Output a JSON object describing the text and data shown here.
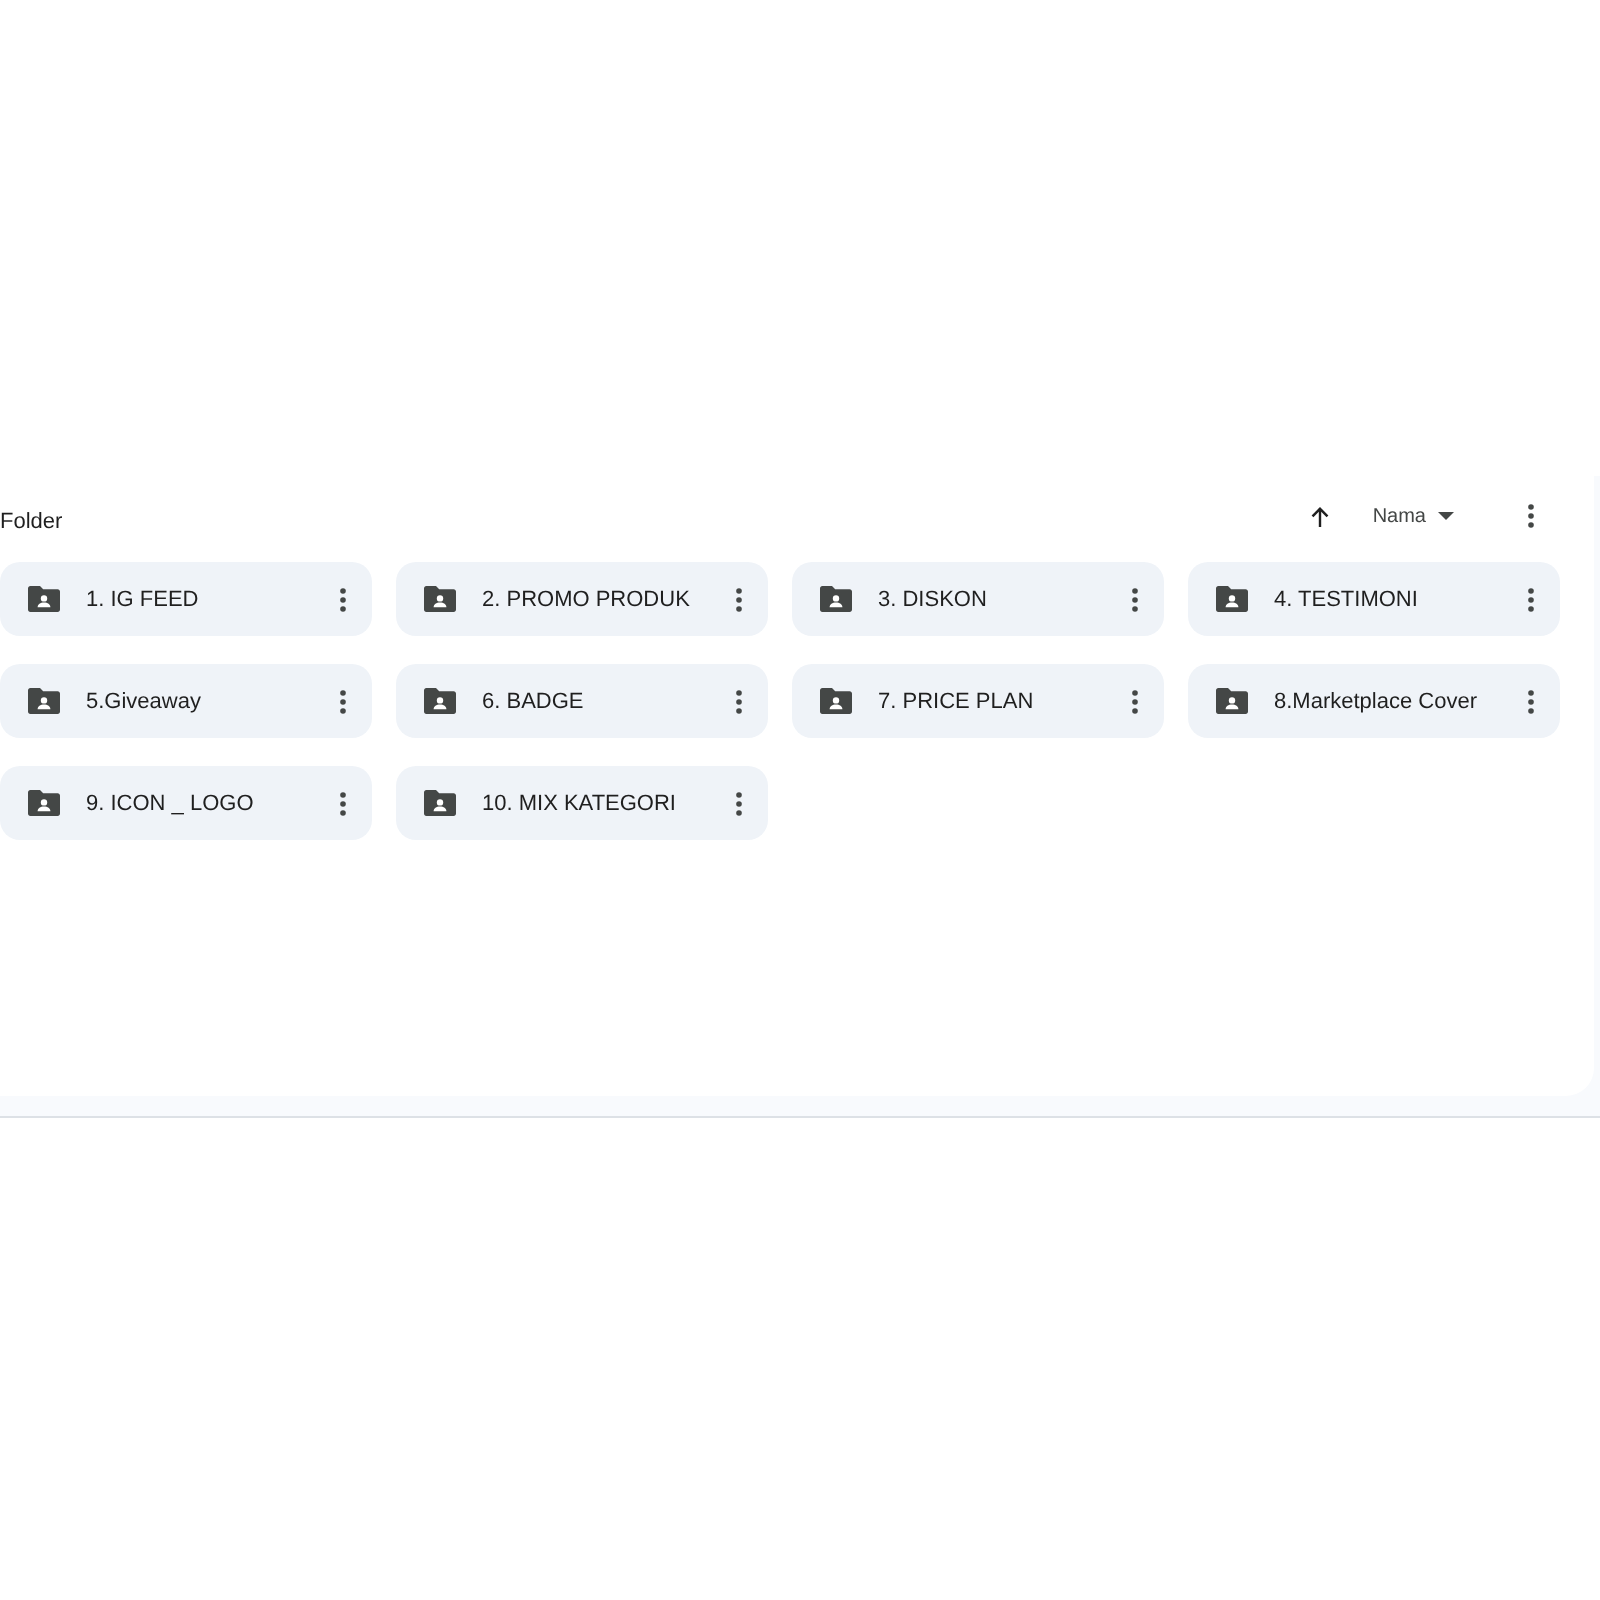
{
  "header": {
    "title": "Folder",
    "sort": {
      "ascending": true,
      "label": "Nama"
    }
  },
  "folders": [
    {
      "name": "1. IG FEED"
    },
    {
      "name": "2. PROMO PRODUK"
    },
    {
      "name": "3. DISKON"
    },
    {
      "name": "4. TESTIMONI"
    },
    {
      "name": "5.Giveaway"
    },
    {
      "name": "6. BADGE"
    },
    {
      "name": "7. PRICE PLAN"
    },
    {
      "name": "8.Marketplace Cover"
    },
    {
      "name": "9. ICON _ LOGO"
    },
    {
      "name": "10. MIX KATEGORI"
    }
  ]
}
